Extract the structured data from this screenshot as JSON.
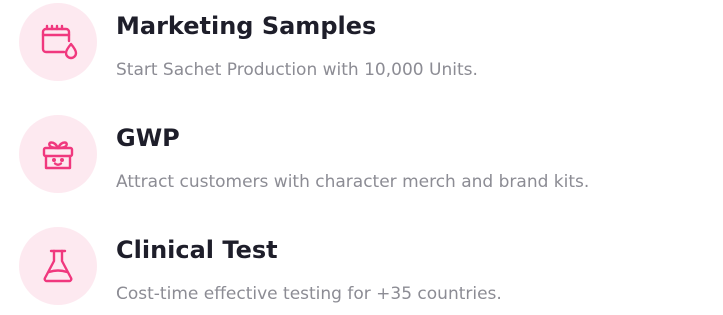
{
  "features": [
    {
      "icon": "sachet-icon",
      "title": "Marketing Samples",
      "description": "Start Sachet Production with 10,000 Units."
    },
    {
      "icon": "gift-icon",
      "title": "GWP",
      "description": "Attract customers with character merch and brand kits."
    },
    {
      "icon": "flask-icon",
      "title": "Clinical Test",
      "description": "Cost-time effective testing for +35 countries."
    }
  ],
  "colors": {
    "accent": "#f0387e",
    "icon_bg": "#fde9f0",
    "title": "#1e1e2a",
    "description": "#8c8c94"
  }
}
